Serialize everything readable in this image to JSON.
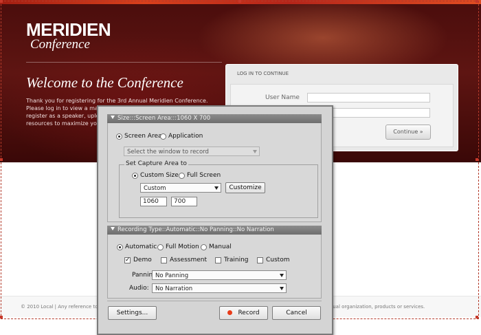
{
  "site": {
    "logo_main": "MERIDIEN",
    "logo_sub": "Conference",
    "welcome": "Welcome to the Conference",
    "intro_lines": [
      "Thank you for registering for the 3rd Annual Meridien Conference.",
      "Please log in to view a map",
      "register as a speaker, uplo",
      "resources to maximize you"
    ],
    "login": {
      "tab_label": "LOG IN TO CONTINUE",
      "username_label": "User Name",
      "continue_label": "Continue »"
    },
    "footer_left": "© 2010 Local | Any reference to Loc",
    "footer_right": "y actual organization, products or services."
  },
  "dialog": {
    "size_header": "Size:::Screen Area:::1060 X 700",
    "capture_mode": {
      "screen_area": "Screen Area",
      "application": "Application",
      "selected": "screen_area"
    },
    "window_select": "Select the window to record",
    "capture_area_legend": "Set Capture Area to",
    "capture_area": {
      "custom_size": "Custom Size",
      "full_screen": "Full Screen",
      "selected": "custom_size"
    },
    "size_preset": "Custom",
    "customize_label": "Customize",
    "width": "1060",
    "height": "700",
    "recording_header": "Recording Type::Automatic::No Panning::No Narration",
    "recording_type": {
      "automatic": "Automatic",
      "full_motion": "Full Motion",
      "manual": "Manual",
      "selected": "automatic"
    },
    "modes": [
      {
        "label": "Demo",
        "checked": true
      },
      {
        "label": "Assessment",
        "checked": false
      },
      {
        "label": "Training",
        "checked": false
      },
      {
        "label": "Custom",
        "checked": false
      }
    ],
    "panning_label": "Panning:",
    "panning_value": "No Panning",
    "audio_label": "Audio:",
    "audio_value": "No Narration",
    "settings_label": "Settings...",
    "record_label": "Record",
    "cancel_label": "Cancel"
  },
  "colors": {
    "hero_dark": "#4a0d0c",
    "section_header": "#7a7a7a",
    "record_dot": "#e83c1a"
  }
}
